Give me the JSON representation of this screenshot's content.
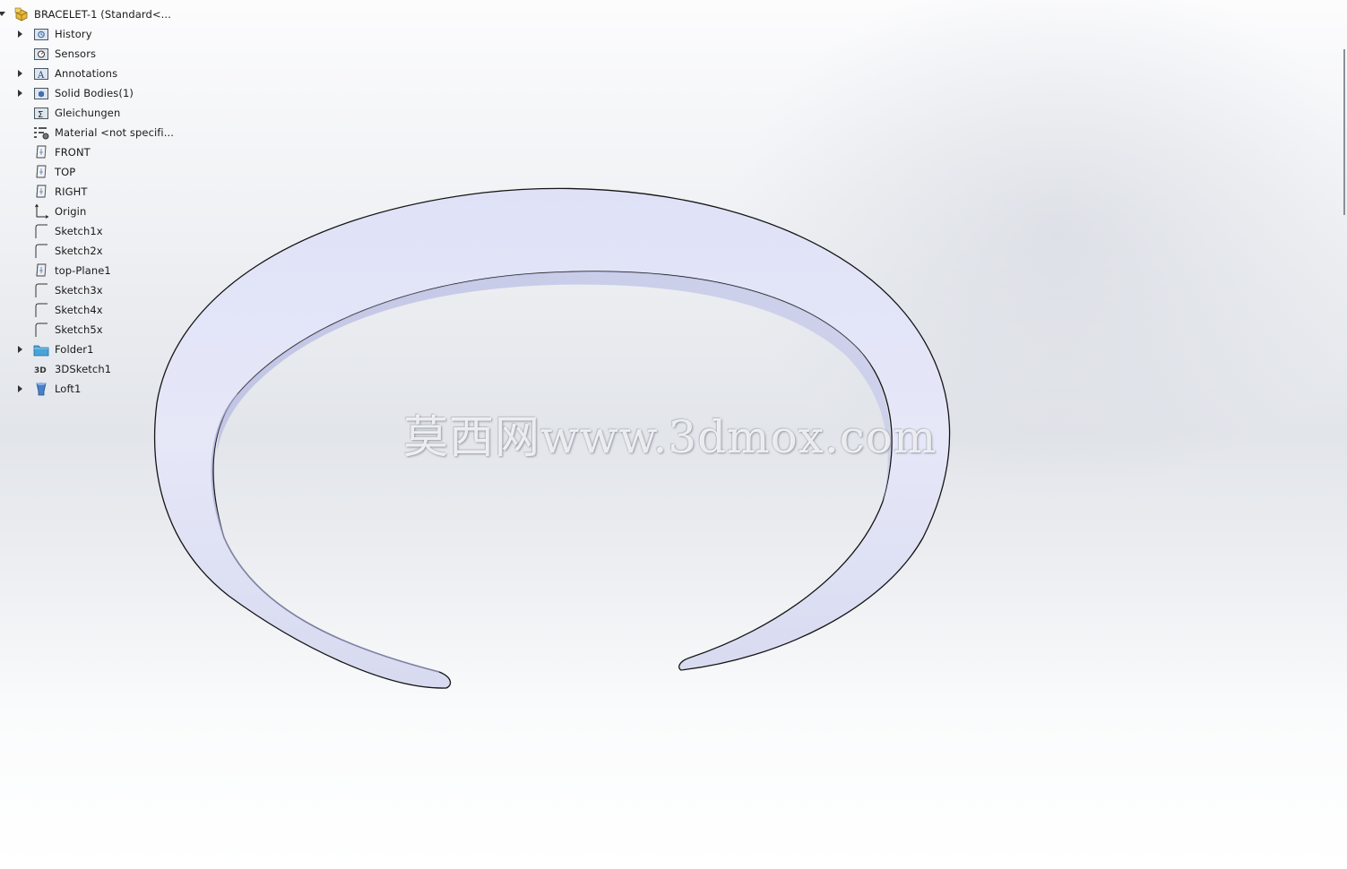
{
  "tree": {
    "root": "BRACELET-1  (Standard<...",
    "items": [
      {
        "label": "History",
        "icon": "history-folder-icon"
      },
      {
        "label": "Sensors",
        "icon": "sensors-folder-icon"
      },
      {
        "label": "Annotations",
        "icon": "annotations-folder-icon"
      },
      {
        "label": "Solid Bodies(1)",
        "icon": "solid-bodies-folder-icon"
      },
      {
        "label": "Gleichungen",
        "icon": "equations-folder-icon"
      },
      {
        "label": "Material <not specifi...",
        "icon": "material-icon"
      },
      {
        "label": "FRONT",
        "icon": "plane-icon"
      },
      {
        "label": "TOP",
        "icon": "plane-icon"
      },
      {
        "label": "RIGHT",
        "icon": "plane-icon"
      },
      {
        "label": "Origin",
        "icon": "origin-icon"
      },
      {
        "label": "Sketch1x",
        "icon": "sketch-icon"
      },
      {
        "label": "Sketch2x",
        "icon": "sketch-icon"
      },
      {
        "label": "top-Plane1",
        "icon": "plane-icon"
      },
      {
        "label": "Sketch3x",
        "icon": "sketch-icon"
      },
      {
        "label": "Sketch4x",
        "icon": "sketch-icon"
      },
      {
        "label": "Sketch5x",
        "icon": "sketch-icon"
      },
      {
        "label": "Folder1",
        "icon": "folder-icon"
      },
      {
        "label": "3DSketch1",
        "icon": "3d-sketch-icon"
      },
      {
        "label": "Loft1",
        "icon": "loft-icon"
      }
    ]
  },
  "watermark": "莫西网www.3dmox.com",
  "colors": {
    "model_fill": "#e4e6f6",
    "model_edge": "#151515",
    "tree_text": "#1a1a1a",
    "folder_blue": "#4aa3d8"
  }
}
